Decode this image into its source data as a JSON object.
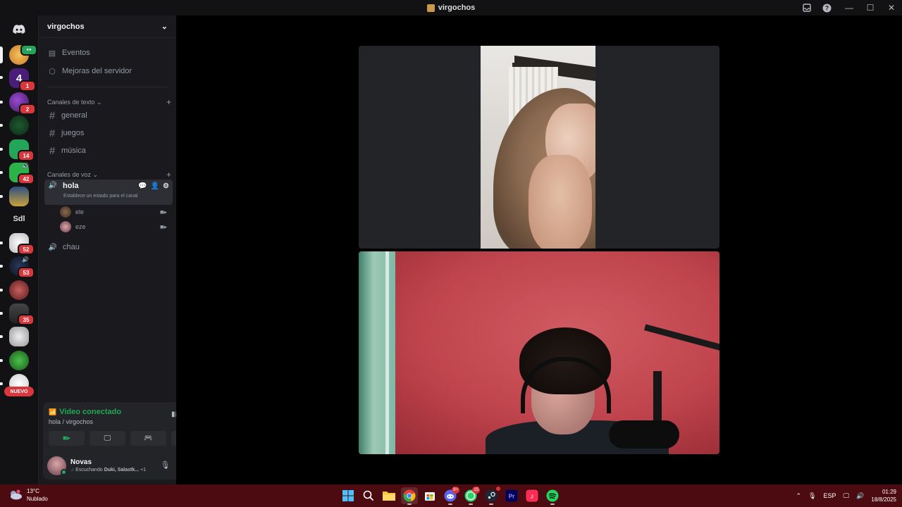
{
  "window": {
    "title": "virgochos"
  },
  "rail": {
    "servers": [
      {
        "name": "virgochos-icon",
        "badge": "",
        "color": "#f0b23b"
      },
      {
        "name": "server-4",
        "badge": "1",
        "color": "#5b2a8c"
      },
      {
        "name": "server-3",
        "badge": "2",
        "color": "#6b2aa0"
      },
      {
        "name": "server-4b",
        "badge": "",
        "color": "#1a8a4a"
      },
      {
        "name": "server-5",
        "badge": "14",
        "color": "#23a55a"
      },
      {
        "name": "server-6",
        "badge": "42",
        "color": "#2bb34a"
      },
      {
        "name": "server-7",
        "badge": "",
        "color": "#3a5fa0"
      },
      {
        "name": "server-sdl",
        "badge": "",
        "color": "#121214"
      },
      {
        "name": "server-9",
        "badge": "52",
        "color": "#e8e8e8"
      },
      {
        "name": "server-10",
        "badge": "53",
        "color": "#1e2a40"
      },
      {
        "name": "server-11",
        "badge": "",
        "color": "#8a2a2a"
      },
      {
        "name": "server-12",
        "badge": "35",
        "color": "#555"
      },
      {
        "name": "server-13",
        "badge": "",
        "color": "#ddd"
      },
      {
        "name": "server-14",
        "badge": "",
        "color": "#2d8a2d"
      },
      {
        "name": "server-15",
        "badge": "",
        "color": "#e8e8e8"
      }
    ],
    "sdl_label": "Sdl",
    "new_label": "NUEVO"
  },
  "sidebar": {
    "guild_name": "virgochos",
    "events_label": "Eventos",
    "boosts_label": "Mejoras del servidor",
    "text_category": "Canales de texto",
    "text_channels": [
      "general",
      "juegos",
      "música"
    ],
    "voice_category": "Canales de voz",
    "voice_channel_active": "hola",
    "voice_channel_status": "Establece un estado para el canal",
    "voice_users": [
      "ele",
      "eze"
    ],
    "voice_channel_other": "chau"
  },
  "voice_panel": {
    "status": "Video conectado",
    "location": "hola / virgochos",
    "user_name": "Novas",
    "activity_prefix": "Escuchando",
    "activity_bold": "Duki, Salastk...",
    "activity_extra": "+1"
  },
  "taskbar": {
    "temp": "13°C",
    "weather": "Nublado",
    "language": "ESP",
    "time": "01:29",
    "date": "18/8/2025",
    "app_badges": {
      "discord": "9+",
      "whatsapp": "15"
    }
  },
  "colors": {
    "accent_green": "#23a55a",
    "badge_red": "#da373c",
    "taskbar": "#4c0b11"
  }
}
